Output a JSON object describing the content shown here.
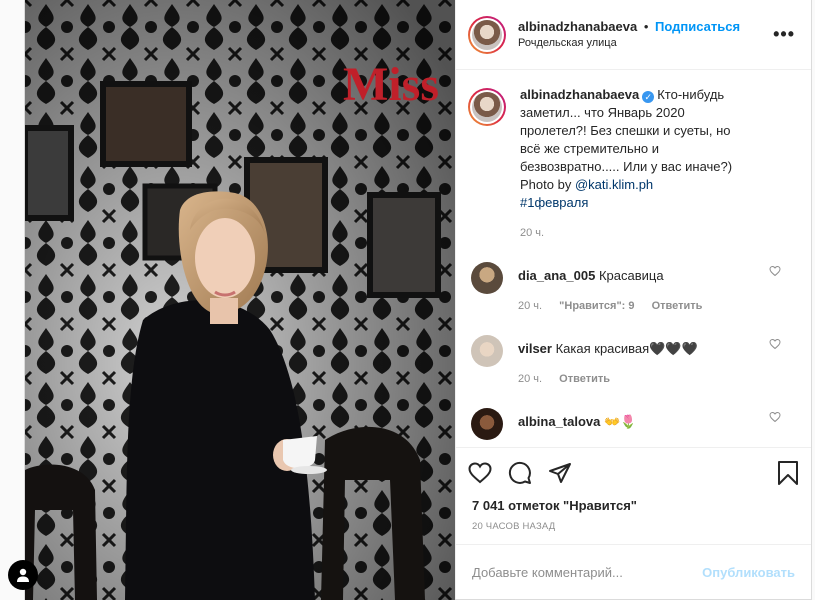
{
  "header": {
    "username": "albinadzhanabaeva",
    "separator": "•",
    "follow_label": "Подписаться",
    "location": "Рочдельская улица",
    "more_label": "•••"
  },
  "caption": {
    "username": "albinadzhanabaeva",
    "text": "Кто-нибудь заметил... что Январь 2020 пролетел?! Без спешки и суеты, но всё же стремительно и безвозвратно..... Или у вас иначе?) Photo by ",
    "mention": "@kati.klim.ph",
    "hashtag": "#1февраля",
    "time": "20 ч."
  },
  "comments": [
    {
      "username": "dia_ana_005",
      "text": "Красавица",
      "time": "20 ч.",
      "likes": "\"Нравится\": 9",
      "reply": "Ответить"
    },
    {
      "username": "vilser",
      "text": "Какая красивая🖤🖤🖤",
      "time": "20 ч.",
      "reply": "Ответить"
    },
    {
      "username": "albina_talova",
      "text": "👐🌷"
    }
  ],
  "likes_text": "7 041 отметок \"Нравится\"",
  "time_ago": "20 ЧАСОВ НАЗАД",
  "comment_input": {
    "placeholder": "Добавьте комментарий..."
  },
  "publish_label": "Опубликовать",
  "photo_sign_text": "Miss",
  "colors": {
    "accent": "#0095f6",
    "publish_disabled": "#b2dffc",
    "muted": "#8e8e8e"
  }
}
